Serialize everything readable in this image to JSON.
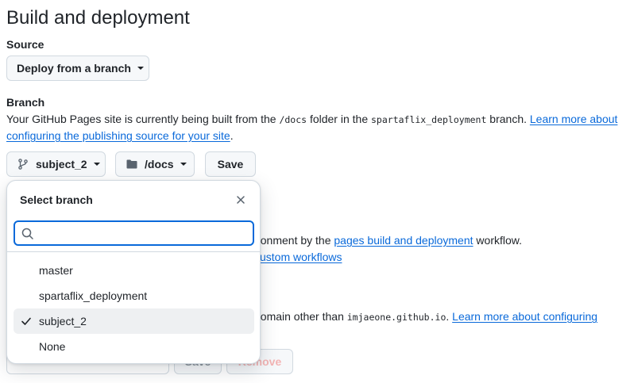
{
  "section": {
    "title": "Build and deployment",
    "source_label": "Source",
    "source_value": "Deploy from a branch",
    "branch_label": "Branch",
    "branch_desc": {
      "prefix": "Your GitHub Pages site is currently being built from the ",
      "folder_code": "/docs",
      "middle": " folder in the ",
      "branch_code": "spartaflix_deployment",
      "suffix": " branch. ",
      "link_line1": "Learn more about",
      "link_line2": "configuring the publishing source for your site",
      "period": "."
    }
  },
  "controls": {
    "branch_button": "subject_2",
    "folder_button": "/docs",
    "save_button": "Save"
  },
  "background": {
    "workflow_prefix": "ironment by the ",
    "workflow_link": "pages build and deployment",
    "workflow_suffix": " workflow.",
    "custom_workflows_link": "custom workflows",
    "domain_prefix": "domain other than ",
    "domain_code": "imjaeone.github.io",
    "domain_period": ". ",
    "domain_link": "Learn more about configuring",
    "save_ghost": "Save",
    "remove_ghost": "Remove"
  },
  "dropdown": {
    "title": "Select branch",
    "search_placeholder": "",
    "items": [
      {
        "label": "master",
        "selected": false
      },
      {
        "label": "spartaflix_deployment",
        "selected": false
      },
      {
        "label": "subject_2",
        "selected": true
      },
      {
        "label": "None",
        "selected": false
      }
    ]
  },
  "colors": {
    "link": "#0969da",
    "border": "#d1d9e0",
    "focus": "#0969da",
    "selected_bg": "#eef0f2"
  }
}
